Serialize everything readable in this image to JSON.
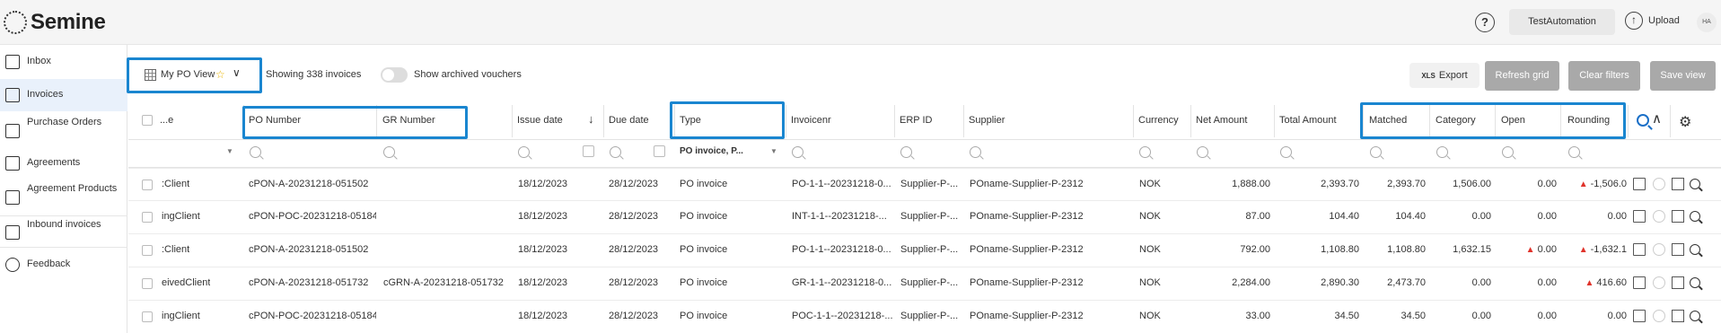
{
  "app": {
    "logo_text": "Semine",
    "user_button": "TestAutomation",
    "upload_label": "Upload",
    "avatar_initials": "HA",
    "help_symbol": "?"
  },
  "sidebar": {
    "items": [
      {
        "label": "Inbox",
        "icon": "mail-icon"
      },
      {
        "label": "Invoices",
        "icon": "document-icon",
        "active": true
      },
      {
        "label": "Purchase Orders",
        "icon": "cart-icon"
      },
      {
        "label": "Agreements",
        "icon": "agreement-icon"
      },
      {
        "label": "Agreement Products",
        "icon": "product-icon"
      },
      {
        "label": "Inbound invoices",
        "icon": "inbound-icon"
      },
      {
        "label": "Feedback",
        "icon": "question-icon"
      }
    ]
  },
  "toolbar": {
    "view_label": "My PO View",
    "showing": "Showing 338 invoices",
    "archived_label": "Show archived vouchers",
    "xls_prefix": "XLS",
    "export_label": "Export",
    "refresh_label": "Refresh grid",
    "clear_label": "Clear filters",
    "save_label": "Save view"
  },
  "columns": [
    "...e",
    "PO Number",
    "GR Number",
    "Issue date",
    "Due date",
    "Type",
    "Invoicenr",
    "ERP ID",
    "Supplier",
    "Currency",
    "Net Amount",
    "Total Amount",
    "Matched",
    "Category",
    "Open",
    "Rounding"
  ],
  "type_filter": "PO invoice, P...",
  "rows": [
    {
      "c0": ":Client",
      "po": "cPON-A-20231218-051502",
      "gr": "",
      "issue": "18/12/2023",
      "due": "28/12/2023",
      "type": "PO invoice",
      "inv": "PO-1-1--20231218-0...",
      "erp": "Supplier-P-...",
      "supplier": "POname-Supplier-P-2312",
      "cur": "NOK",
      "net": "1,888.00",
      "total": "2,393.70",
      "matched": "2,393.70",
      "category": "1,506.00",
      "open": "0.00",
      "open_warn": false,
      "rounding": "-1,506.0",
      "round_warn": true
    },
    {
      "c0": "ingClient",
      "po": "cPON-POC-20231218-05184",
      "gr": "",
      "issue": "18/12/2023",
      "due": "28/12/2023",
      "type": "PO invoice",
      "inv": "INT-1-1--20231218-...",
      "erp": "Supplier-P-...",
      "supplier": "POname-Supplier-P-2312",
      "cur": "NOK",
      "net": "87.00",
      "total": "104.40",
      "matched": "104.40",
      "category": "0.00",
      "open": "0.00",
      "open_warn": false,
      "rounding": "0.00",
      "round_warn": false
    },
    {
      "c0": ":Client",
      "po": "cPON-A-20231218-051502",
      "gr": "",
      "issue": "18/12/2023",
      "due": "28/12/2023",
      "type": "PO invoice",
      "inv": "PO-1-1--20231218-0...",
      "erp": "Supplier-P-...",
      "supplier": "POname-Supplier-P-2312",
      "cur": "NOK",
      "net": "792.00",
      "total": "1,108.80",
      "matched": "1,108.80",
      "category": "1,632.15",
      "open": "0.00",
      "open_warn": true,
      "rounding": "-1,632.1",
      "round_warn": true
    },
    {
      "c0": "eivedClient",
      "po": "cPON-A-20231218-051732",
      "gr": "cGRN-A-20231218-051732",
      "issue": "18/12/2023",
      "due": "28/12/2023",
      "type": "PO invoice",
      "inv": "GR-1-1--20231218-0...",
      "erp": "Supplier-P-...",
      "supplier": "POname-Supplier-P-2312",
      "cur": "NOK",
      "net": "2,284.00",
      "total": "2,890.30",
      "matched": "2,473.70",
      "category": "0.00",
      "open": "0.00",
      "open_warn": false,
      "rounding": "416.60",
      "round_warn": true
    },
    {
      "c0": "ingClient",
      "po": "cPON-POC-20231218-05184",
      "gr": "",
      "issue": "18/12/2023",
      "due": "28/12/2023",
      "type": "PO invoice",
      "inv": "POC-1-1--20231218-...",
      "erp": "Supplier-P-...",
      "supplier": "POname-Supplier-P-2312",
      "cur": "NOK",
      "net": "33.00",
      "total": "34.50",
      "matched": "34.50",
      "category": "0.00",
      "open": "0.00",
      "open_warn": false,
      "rounding": "0.00",
      "round_warn": false
    }
  ],
  "colors": {
    "highlight": "#1a86d0",
    "warning": "#e0332b",
    "button_gray": "#a9a9a9",
    "active_nav": "#e9f1fb"
  }
}
